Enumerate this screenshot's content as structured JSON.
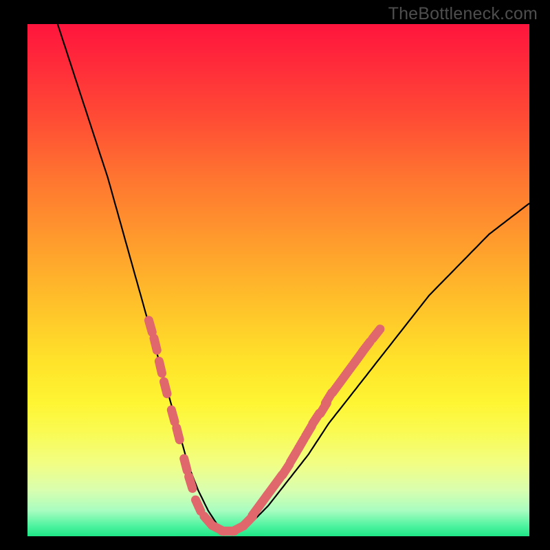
{
  "watermark": "TheBottleneck.com",
  "colors": {
    "background": "#000000",
    "curve": "#000000",
    "marker": "#e0676b",
    "gradient_top": "#ff153d",
    "gradient_bottom": "#1ee687"
  },
  "chart_data": {
    "type": "line",
    "title": "",
    "xlabel": "",
    "ylabel": "",
    "xlim": [
      0,
      100
    ],
    "ylim": [
      0,
      100
    ],
    "grid": false,
    "legend": false,
    "curve_note": "V-shaped bottleneck curve: steep descent on left, minimum ~x=33-40, gentler rise to right; y ~0-3 at minimum, ~100 at left edge, ~65 at right edge",
    "x": [
      6,
      8,
      10,
      12,
      14,
      16,
      18,
      20,
      22,
      24,
      26,
      28,
      30,
      32,
      34,
      36,
      38,
      40,
      42,
      44,
      46,
      48,
      52,
      56,
      60,
      64,
      68,
      72,
      76,
      80,
      84,
      88,
      92,
      96,
      100
    ],
    "y": [
      100,
      94,
      88,
      82,
      76,
      70,
      63,
      56,
      49,
      42,
      35,
      28,
      21,
      14,
      9,
      5,
      2,
      1,
      1,
      2,
      4,
      6,
      11,
      16,
      22,
      27,
      32,
      37,
      42,
      47,
      51,
      55,
      59,
      62,
      65
    ],
    "markers_note": "salmon rounded markers along curve near bottom region (green band)",
    "markers": [
      {
        "x": 24.5,
        "y": 41
      },
      {
        "x": 25.5,
        "y": 37.5
      },
      {
        "x": 26.5,
        "y": 33
      },
      {
        "x": 27.5,
        "y": 29
      },
      {
        "x": 29,
        "y": 23.5
      },
      {
        "x": 30,
        "y": 20
      },
      {
        "x": 31.5,
        "y": 14
      },
      {
        "x": 32.5,
        "y": 10.5
      },
      {
        "x": 34,
        "y": 6
      },
      {
        "x": 36,
        "y": 3
      },
      {
        "x": 38,
        "y": 1.5
      },
      {
        "x": 40,
        "y": 1
      },
      {
        "x": 42,
        "y": 1.5
      },
      {
        "x": 44,
        "y": 3
      },
      {
        "x": 45.5,
        "y": 5
      },
      {
        "x": 47,
        "y": 7
      },
      {
        "x": 48.5,
        "y": 9
      },
      {
        "x": 50,
        "y": 11
      },
      {
        "x": 51.5,
        "y": 13
      },
      {
        "x": 53,
        "y": 15.5
      },
      {
        "x": 54.5,
        "y": 18
      },
      {
        "x": 56,
        "y": 20.5
      },
      {
        "x": 57.5,
        "y": 23
      },
      {
        "x": 59,
        "y": 25
      },
      {
        "x": 60,
        "y": 27
      },
      {
        "x": 61.5,
        "y": 29
      },
      {
        "x": 63,
        "y": 31
      },
      {
        "x": 64.5,
        "y": 33
      },
      {
        "x": 66,
        "y": 35
      },
      {
        "x": 67.5,
        "y": 37
      },
      {
        "x": 69.5,
        "y": 39.5
      }
    ]
  }
}
